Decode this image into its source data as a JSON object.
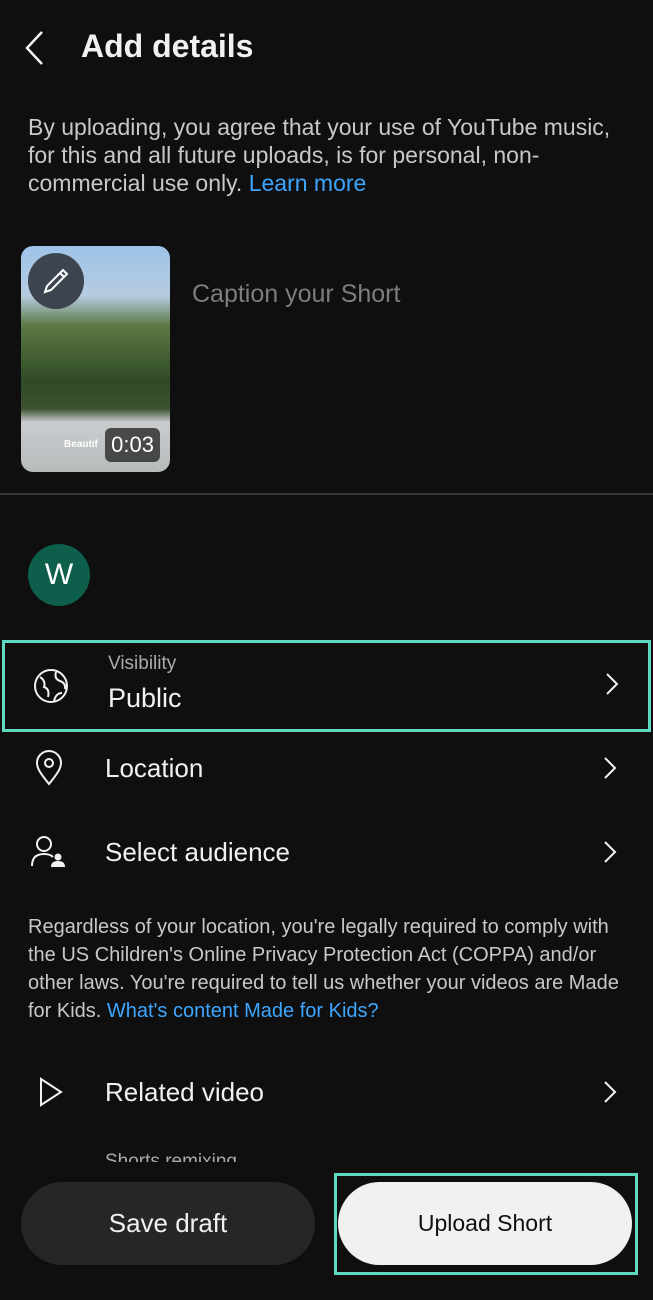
{
  "header": {
    "title": "Add details",
    "back_icon": "chevron-left-icon"
  },
  "notice": {
    "text": "By uploading, you agree that your use of YouTube music, for this and all future uploads, is for personal, non-commercial use only. ",
    "link": "Learn more"
  },
  "video": {
    "duration": "0:03",
    "overlay_text": "Beautif",
    "edit_icon": "pencil-icon"
  },
  "caption": {
    "placeholder": "Caption your Short"
  },
  "channel": {
    "avatar_letter": "W",
    "avatar_color": "#0d5e4b"
  },
  "rows": {
    "visibility": {
      "label": "Visibility",
      "value": "Public",
      "icon": "globe-icon"
    },
    "location": {
      "label": "Location",
      "icon": "location-pin-icon"
    },
    "audience": {
      "label": "Select audience",
      "icon": "person-icon"
    },
    "related": {
      "label": "Related video",
      "icon": "play-icon"
    }
  },
  "coppa": {
    "text": "Regardless of your location, you're legally required to comply with the US Children's Online Privacy Protection Act (COPPA) and/or other laws. You're required to tell us whether your videos are Made for Kids. ",
    "link": "What's content Made for Kids?"
  },
  "remix": {
    "label": "Shorts remixing"
  },
  "buttons": {
    "save": "Save draft",
    "upload": "Upload Short"
  },
  "colors": {
    "background": "#0f0f0f",
    "link": "#3ea6ff",
    "highlight": "#5fd9c1"
  }
}
